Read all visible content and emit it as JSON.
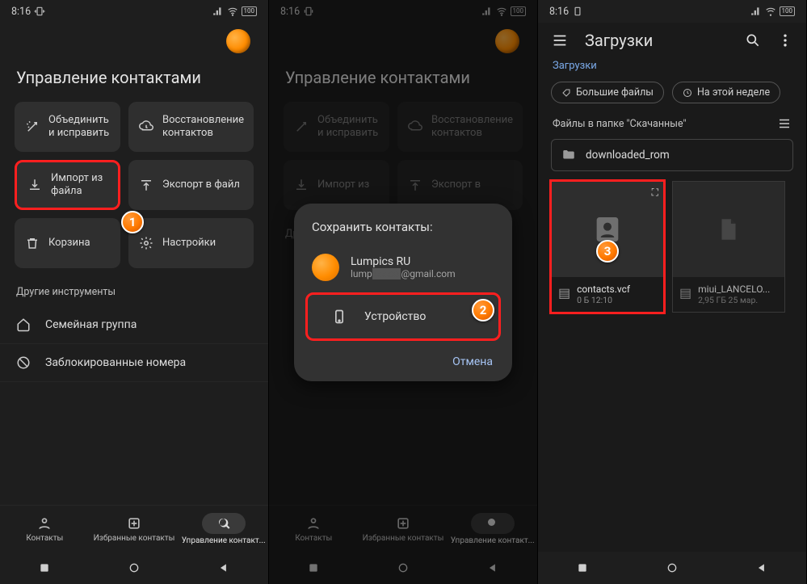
{
  "status": {
    "time": "8:16",
    "battery": "100"
  },
  "panel1": {
    "title": "Управление контактами",
    "tiles": {
      "merge": "Объединить и исправить",
      "restore": "Восстановление контактов",
      "import": "Импорт из файла",
      "export": "Экспорт в файл",
      "trash": "Корзина",
      "settings": "Настройки"
    },
    "other_label": "Другие инструменты",
    "family": "Семейная группа",
    "blocked": "Заблокированные номера",
    "bottomnav": {
      "contacts": "Контакты",
      "favorites": "Избранные контакты",
      "manage": "Управление контакт..."
    },
    "badge": "1"
  },
  "panel2": {
    "title": "Управление контактами",
    "tiles": {
      "merge": "Объединить и исправить",
      "restore": "Восстановление контактов",
      "import": "Импорт из",
      "export": "Экспорт в"
    },
    "other_label": "Др",
    "dialog": {
      "title": "Сохранить контакты:",
      "account_name": "Lumpics RU",
      "account_email_prefix": "lump",
      "account_email_suffix": "@gmail.com",
      "device": "Устройство",
      "cancel": "Отмена"
    },
    "bottomnav": {
      "contacts": "Контакты",
      "favorites": "Избранные контакты",
      "manage": "Управление контакт..."
    },
    "badge": "2"
  },
  "panel3": {
    "topbar_title": "Загрузки",
    "crumb": "Загрузки",
    "chip_big": "Большие файлы",
    "chip_week": "На этой неделе",
    "files_header": "Файлы в папке \"Скачанные\"",
    "folder": "downloaded_rom",
    "file1": {
      "name": "contacts.vcf",
      "sub": "0 Б 12:10"
    },
    "file2": {
      "name": "miui_LANCELO...",
      "sub": "2,95 ГБ 25 мар."
    },
    "badge": "3"
  }
}
